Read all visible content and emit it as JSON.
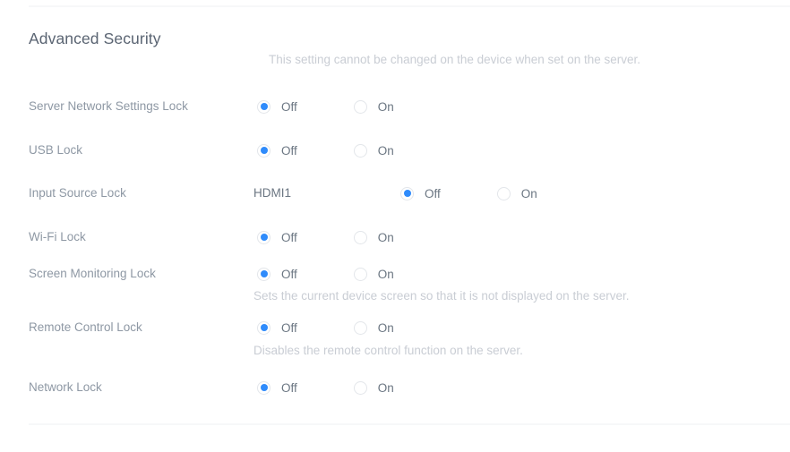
{
  "section": {
    "title": "Advanced Security",
    "note": "This setting cannot be changed on the device when set on the server."
  },
  "options": {
    "off": "Off",
    "on": "On"
  },
  "colors": {
    "accent": "#2f8bfb",
    "label": "#8e98a4",
    "value": "#6b7682",
    "muted": "#c9cdd4",
    "divider": "#f7f8f9",
    "background": "#ffffff"
  },
  "rows": [
    {
      "label": "Server Network Settings Lock",
      "value": "",
      "selected": "off",
      "description": ""
    },
    {
      "label": "USB Lock",
      "value": "",
      "selected": "off",
      "description": ""
    },
    {
      "label": "Input Source Lock",
      "value": "HDMI1",
      "selected": "off",
      "description": ""
    },
    {
      "label": "Wi-Fi Lock",
      "value": "",
      "selected": "off",
      "description": ""
    },
    {
      "label": "Screen Monitoring Lock",
      "value": "",
      "selected": "off",
      "description": "Sets the current device screen so that it is not displayed on the server."
    },
    {
      "label": "Remote Control Lock",
      "value": "",
      "selected": "off",
      "description": "Disables the remote control function on the server."
    },
    {
      "label": "Network Lock",
      "value": "",
      "selected": "off",
      "description": ""
    }
  ]
}
